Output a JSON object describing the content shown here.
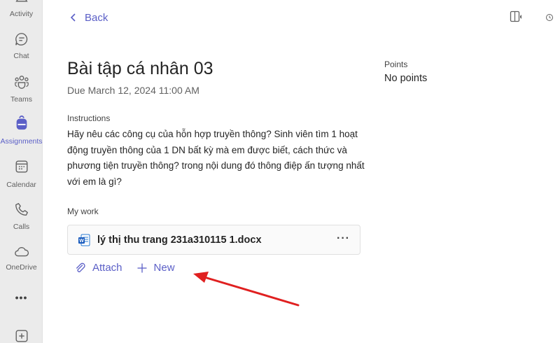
{
  "rail": {
    "items": [
      {
        "label": "Activity",
        "icon": "bell-icon"
      },
      {
        "label": "Chat",
        "icon": "chat-icon"
      },
      {
        "label": "Teams",
        "icon": "teams-icon"
      },
      {
        "label": "Assignments",
        "icon": "backpack-icon"
      },
      {
        "label": "Calendar",
        "icon": "calendar-icon"
      },
      {
        "label": "Calls",
        "icon": "phone-icon"
      },
      {
        "label": "OneDrive",
        "icon": "cloud-icon"
      }
    ],
    "more_label": "•••",
    "active_color": "#5b5fc7"
  },
  "header": {
    "back_label": "Back"
  },
  "assignment": {
    "title": "Bài tập cá nhân 03",
    "due": "Due March 12, 2024 11:00 AM",
    "instructions_label": "Instructions",
    "instructions_text": "Hãy nêu các công cụ của hỗn hợp truyền thông? Sinh viên tìm 1 hoạt động truyền thông của 1 DN bất kỳ mà em được biết, cách thức và phương tiện truyền thông? trong nội dung đó thông điệp ấn tượng nhất với em là gì?",
    "points_label": "Points",
    "points_value": "No points",
    "my_work_label": "My work",
    "file_name": "lý thị thu trang 231a310115 1.docx",
    "file_more": "···",
    "attach_label": "Attach",
    "new_label": "New"
  },
  "colors": {
    "accent": "#5b5fc7",
    "annotation_arrow": "#e02020"
  }
}
